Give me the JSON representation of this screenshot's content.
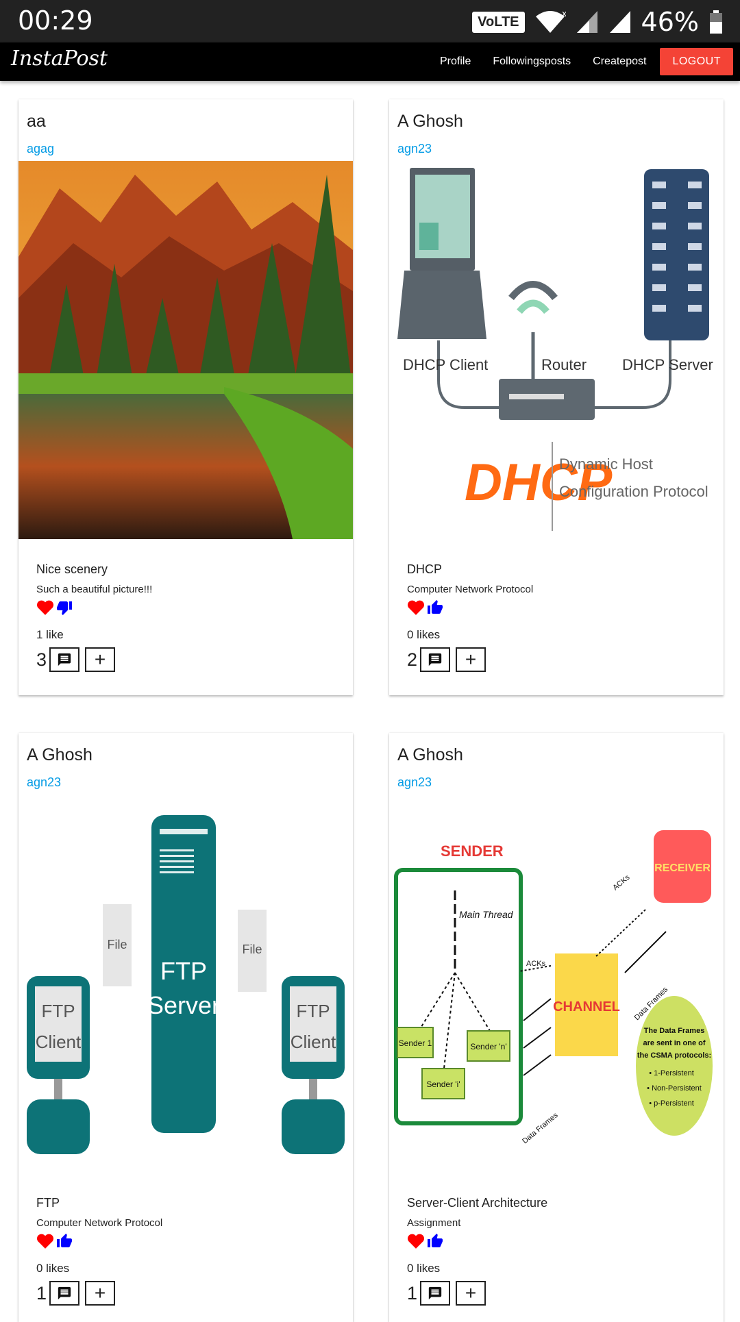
{
  "status": {
    "time": "00:29",
    "volte": "VoLTE",
    "battery": "46%"
  },
  "nav": {
    "brand": "InstaPost",
    "links": [
      "Profile",
      "Followingsposts",
      "Createpost"
    ],
    "logout": "LOGOUT"
  },
  "colors": {
    "accent": "#f44336",
    "handle": "#039be5",
    "heart": "#ff0000",
    "thumb": "#0000ff"
  },
  "posts": [
    {
      "name": "aa",
      "handle": "agag",
      "image": "mountain-lake-scenery",
      "title": "Nice scenery",
      "body": "Such a beautiful picture!!!",
      "liked": true,
      "reaction": "thumb-down",
      "likes": "1 like",
      "comments": "3"
    },
    {
      "name": "A Ghosh",
      "handle": "agn23",
      "image": "dhcp-diagram",
      "image_text": {
        "client": "DHCP Client",
        "router": "Router",
        "server": "DHCP Server",
        "logo": "DHCP",
        "tagline1": "Dynamic Host",
        "tagline2": "Configuration Protocol"
      },
      "title": "DHCP",
      "body": "Computer Network Protocol",
      "liked": true,
      "reaction": "thumb-up",
      "likes": "0 likes",
      "comments": "2"
    },
    {
      "name": "A Ghosh",
      "handle": "agn23",
      "image": "ftp-diagram",
      "image_text": {
        "file": "File",
        "server1": "FTP",
        "server2": "Server",
        "client1": "FTP",
        "client2": "Client"
      },
      "title": "FTP",
      "body": "Computer Network Protocol",
      "liked": true,
      "reaction": "thumb-up",
      "likes": "0 likes",
      "comments": "1"
    },
    {
      "name": "A Ghosh",
      "handle": "agn23",
      "image": "sender-receiver-diagram",
      "image_text": {
        "sender": "SENDER",
        "receiver": "RECEIVER",
        "channel": "CHANNEL",
        "main": "Main Thread",
        "s1": "Sender 1",
        "sn": "Sender 'n'",
        "si": "Sender 'i'",
        "acks": "ACKs",
        "frames": "Data Frames",
        "note": [
          "The Data Frames",
          "are sent in one of",
          "the CSMA protocols:",
          "• 1-Persistent",
          "• Non-Persistent",
          "• p-Persistent"
        ]
      },
      "title": "Server-Client Architecture",
      "body": "Assignment",
      "liked": true,
      "reaction": "thumb-up",
      "likes": "0 likes",
      "comments": "1"
    }
  ]
}
